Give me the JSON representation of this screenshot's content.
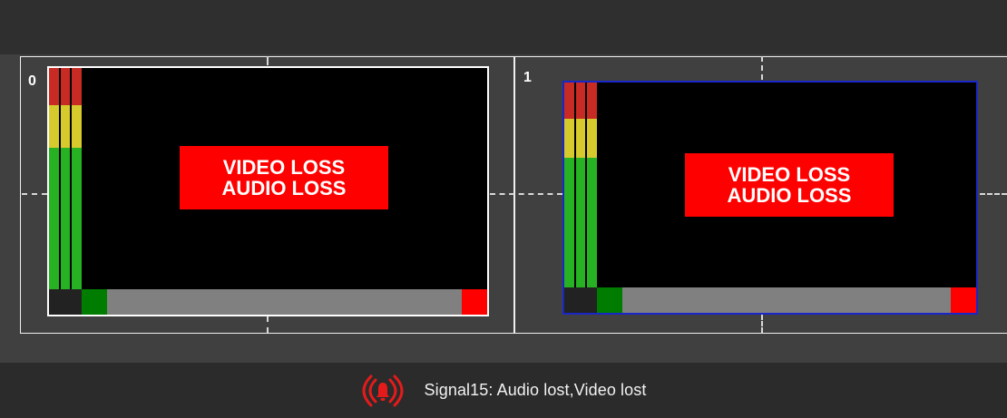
{
  "cells": [
    {
      "index": "0",
      "video_loss": "VIDEO LOSS",
      "audio_loss": "AUDIO LOSS"
    },
    {
      "index": "1",
      "video_loss": "VIDEO LOSS",
      "audio_loss": "AUDIO LOSS"
    }
  ],
  "status_bar": {
    "alarm_icon": "alarm-bell-icon",
    "message": "Signal15: Audio lost,Video lost"
  },
  "colors": {
    "loss_badge": "#ff0000",
    "selected_border": "#1a27c8",
    "meter_red": "#c82a24",
    "meter_yellow": "#d7ca2c",
    "meter_green": "#27b223",
    "strip_green": "#007d00",
    "strip_red": "#ff0000"
  }
}
